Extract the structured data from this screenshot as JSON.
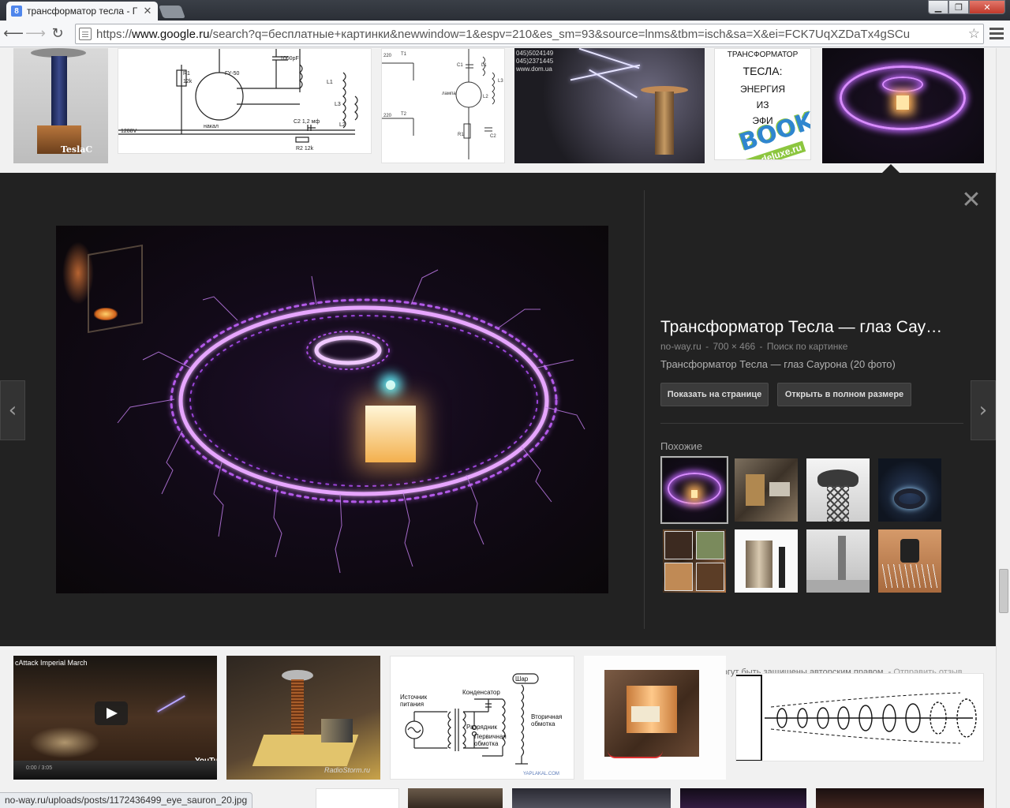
{
  "browser": {
    "tab_title": "трансформатор тесла - Г",
    "favicon_letter": "8",
    "url_scheme": "https://",
    "url_domain": "www.google.ru",
    "url_path": "/search?q=бесплатные+картинки&newwindow=1&espv=210&es_sm=93&source=lnms&tbm=isch&sa=X&ei=FCK7UqXZDaTx4gSCu",
    "status_url": "no-way.ru/uploads/posts/1172436499_eye_sauron_20.jpg"
  },
  "top_row": {
    "tesla_label": "TeslaC",
    "schem1_labels": [
      "ГУ-50",
      "1000pF",
      "R1",
      "12k",
      "C2 1,2 мф",
      "R2 12k",
      "L1",
      "L2",
      "L3",
      "накал",
      "1288V"
    ],
    "schem2_labels": [
      "220",
      "T1",
      "T2",
      "лампа",
      "C1",
      "C2",
      "R1",
      "L1",
      "L2",
      "L3"
    ],
    "photo_text": [
      "045)5024149",
      "045)2371445",
      "www.dom.ua"
    ],
    "book_lines": [
      "ТРАНСФОРМАТОР",
      "ТЕСЛА:",
      "ЭНЕРГИЯ",
      "ИЗ",
      "ЭФИ"
    ],
    "book_badge": "BOOK",
    "book_site": "ru-deluxe.ru"
  },
  "detail": {
    "title": "Трансформатор Тесла — глаз Сау…",
    "source": "no-way.ru",
    "dimensions": "700 × 466",
    "search_by_image": "Поиск по картинке",
    "description": "Трансформатор Тесла — глаз Саурона (20 фото)",
    "btn_visit": "Показать на странице",
    "btn_full": "Открыть в полном размере",
    "similar_label": "Похожие",
    "copyright_note": "Изображения могут быть защищены авторским правом.",
    "feedback_link": "Отправить отзыв",
    "close_glyph": "✕",
    "prev_glyph": "‹",
    "next_glyph": "›"
  },
  "bottom_row": {
    "video_title": "cAttack Imperial March",
    "video_brand": "YouTube",
    "video_time": "0:00 / 3:05",
    "watermark": "RadioStorm.ru",
    "diagram_labels": {
      "source": "Источник питания",
      "capacitor": "Конденсатор",
      "spark_gap": "Разрядник",
      "primary": "Первичная обмотка",
      "secondary": "Вторичная обмотка",
      "ball": "Шар",
      "site": "YAPLAKAL.COM"
    }
  },
  "colors": {
    "panel_bg": "#222222",
    "page_bg": "#f1f1f1",
    "ring_purple": "#d98cff",
    "link_grey": "#9b9b9b"
  }
}
